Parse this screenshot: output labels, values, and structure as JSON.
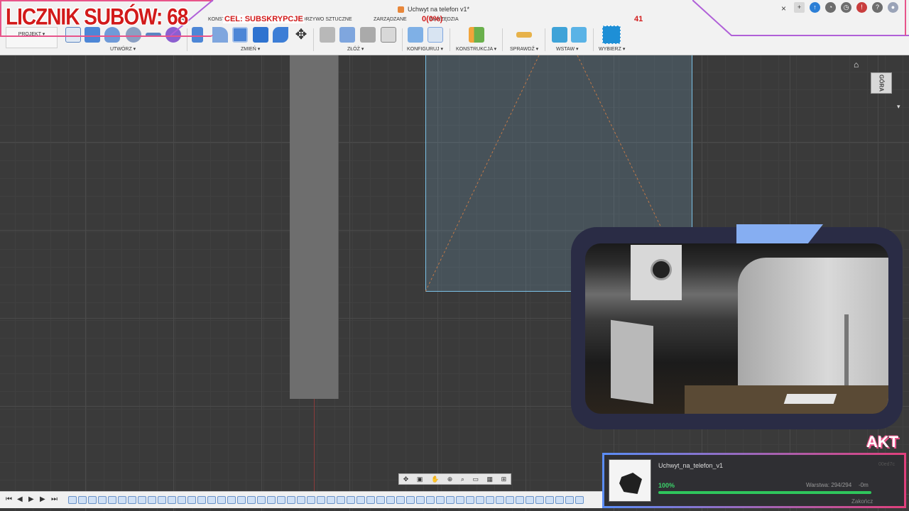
{
  "overlay": {
    "sub_counter": "LICZNIK SUBÓW: 68",
    "goal_label": "CEL: SUBSKRYPCJE",
    "goal_count": "0(0%)",
    "goal_target": "41",
    "akt_label": "AKT"
  },
  "document": {
    "title": "Uchwyt na telefon v1*",
    "close": "×"
  },
  "toolbar_tabs": [
    "KONST",
    "TWORZYWO SZTUCZNE",
    "ZARZĄDZANE",
    "NARZĘDZIA"
  ],
  "toolbar_tabs_partial": "KA",
  "project_label": "PROJEKT ▾",
  "tool_groups": [
    {
      "label": "UTWÓRZ ▾"
    },
    {
      "label": "ZMIEŃ ▾"
    },
    {
      "label": "ZŁÓŻ ▾"
    },
    {
      "label": "KONFIGURUJ ▾"
    },
    {
      "label": "KONSTRUKCJA ▾"
    },
    {
      "label": "SPRAWDŹ ▾"
    },
    {
      "label": "WSTAW ▾"
    },
    {
      "label": "WYBIERZ ▾"
    }
  ],
  "viewcube": {
    "face_label": "GÓRA"
  },
  "print_job": {
    "name": "Uchwyt_na_telefon_v1",
    "percent": "100%",
    "progress": 1.0,
    "layer": "Warstwa: 294/294",
    "remaining": "-0m",
    "end": "Zakończ",
    "job_id": "00ed7c"
  },
  "colors": {
    "accent_blue": "#2c7fd6",
    "overlay_red": "#d21a1a",
    "overlay_pink": "#e8548a",
    "progress_green": "#2fc55c"
  }
}
